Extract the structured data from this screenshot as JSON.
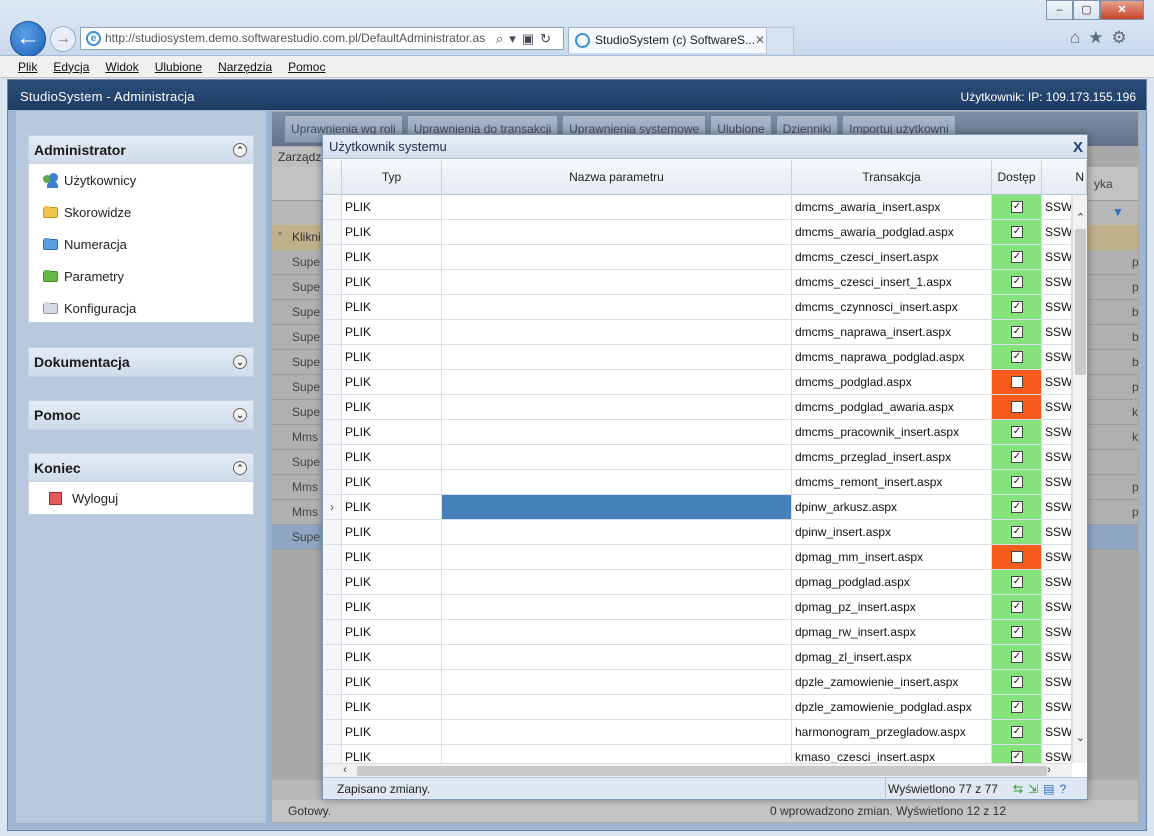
{
  "browser": {
    "url": "http://studiosystem.demo.softwarestudio.com.pl/DefaultAdministrator.as",
    "tab_title": "StudioSystem (c) SoftwareS...",
    "tab_close": "✕"
  },
  "menu": [
    "Plik",
    "Edycja",
    "Widok",
    "Ulubione",
    "Narzędzia",
    "Pomoc"
  ],
  "app": {
    "title": "StudioSystem - Administracja",
    "user": "Użytkownik: IP: 109.173.155.196"
  },
  "nav": {
    "administrator": {
      "title": "Administrator",
      "items": [
        "Użytkownicy",
        "Skorowidze",
        "Numeracja",
        "Parametry",
        "Konfiguracja"
      ]
    },
    "dokumentacja": {
      "title": "Dokumentacja"
    },
    "pomoc": {
      "title": "Pomoc"
    },
    "koniec": {
      "title": "Koniec",
      "items": [
        "Wyloguj"
      ]
    }
  },
  "background": {
    "toolbar": [
      "Uprawnienia wg roli",
      "Uprawnienia do transakcji",
      "Uprawnienia systemowe",
      "Ulubione",
      "Dzienniki",
      "Importuj użytkowni"
    ],
    "section_label": "Zarządz",
    "header_fragment": "yka",
    "new_row": "Klikni",
    "rows": [
      {
        "c1": "Supe",
        "c2": "p"
      },
      {
        "c1": "Supe",
        "c2": "p"
      },
      {
        "c1": "Supe",
        "c2": "b"
      },
      {
        "c1": "Supe",
        "c2": "b"
      },
      {
        "c1": "Supe",
        "c2": "b"
      },
      {
        "c1": "Supe",
        "c2": "p"
      },
      {
        "c1": "Supe",
        "c2": "k"
      },
      {
        "c1": "Mms",
        "c2": "k"
      },
      {
        "c1": "Supe",
        "c2": ""
      },
      {
        "c1": "Mms",
        "c2": "p"
      },
      {
        "c1": "Mms",
        "c2": "p"
      },
      {
        "c1": "Supe",
        "c2": ""
      }
    ],
    "status_left": "Gotowy.",
    "status_right": "0 wprowadzono zmian.  Wyświetlono 12 z 12"
  },
  "modal": {
    "title": "Użytkownik systemu",
    "close": "X",
    "columns": {
      "typ": "Typ",
      "nazwa": "Nazwa parametru",
      "transakcja": "Transakcja",
      "dostep": "Dostęp",
      "more": "N"
    },
    "rows": [
      {
        "typ": "PLIK",
        "param": "",
        "trans": "dmcms_awaria_insert.aspx",
        "dostep": true,
        "more": "SSW"
      },
      {
        "typ": "PLIK",
        "param": "",
        "trans": "dmcms_awaria_podglad.aspx",
        "dostep": true,
        "more": "SSW"
      },
      {
        "typ": "PLIK",
        "param": "",
        "trans": "dmcms_czesci_insert.aspx",
        "dostep": true,
        "more": "SSW"
      },
      {
        "typ": "PLIK",
        "param": "",
        "trans": "dmcms_czesci_insert_1.aspx",
        "dostep": true,
        "more": "SSW"
      },
      {
        "typ": "PLIK",
        "param": "",
        "trans": "dmcms_czynnosci_insert.aspx",
        "dostep": true,
        "more": "SSW"
      },
      {
        "typ": "PLIK",
        "param": "",
        "trans": "dmcms_naprawa_insert.aspx",
        "dostep": true,
        "more": "SSW"
      },
      {
        "typ": "PLIK",
        "param": "",
        "trans": "dmcms_naprawa_podglad.aspx",
        "dostep": true,
        "more": "SSW"
      },
      {
        "typ": "PLIK",
        "param": "",
        "trans": "dmcms_podglad.aspx",
        "dostep": false,
        "more": "SSW"
      },
      {
        "typ": "PLIK",
        "param": "",
        "trans": "dmcms_podglad_awaria.aspx",
        "dostep": false,
        "more": "SSW"
      },
      {
        "typ": "PLIK",
        "param": "",
        "trans": "dmcms_pracownik_insert.aspx",
        "dostep": true,
        "more": "SSW"
      },
      {
        "typ": "PLIK",
        "param": "",
        "trans": "dmcms_przeglad_insert.aspx",
        "dostep": true,
        "more": "SSW"
      },
      {
        "typ": "PLIK",
        "param": "",
        "trans": "dmcms_remont_insert.aspx",
        "dostep": true,
        "more": "SSW"
      },
      {
        "typ": "PLIK",
        "param": "",
        "trans": "dpinw_arkusz.aspx",
        "dostep": true,
        "more": "SSW",
        "selected": true
      },
      {
        "typ": "PLIK",
        "param": "",
        "trans": "dpinw_insert.aspx",
        "dostep": true,
        "more": "SSW"
      },
      {
        "typ": "PLIK",
        "param": "",
        "trans": "dpmag_mm_insert.aspx",
        "dostep": false,
        "more": "SSW"
      },
      {
        "typ": "PLIK",
        "param": "",
        "trans": "dpmag_podglad.aspx",
        "dostep": true,
        "more": "SSW"
      },
      {
        "typ": "PLIK",
        "param": "",
        "trans": "dpmag_pz_insert.aspx",
        "dostep": true,
        "more": "SSW"
      },
      {
        "typ": "PLIK",
        "param": "",
        "trans": "dpmag_rw_insert.aspx",
        "dostep": true,
        "more": "SSW"
      },
      {
        "typ": "PLIK",
        "param": "",
        "trans": "dpmag_zl_insert.aspx",
        "dostep": true,
        "more": "SSW"
      },
      {
        "typ": "PLIK",
        "param": "",
        "trans": "dpzle_zamowienie_insert.aspx",
        "dostep": true,
        "more": "SSW"
      },
      {
        "typ": "PLIK",
        "param": "",
        "trans": "dpzle_zamowienie_podglad.aspx",
        "dostep": true,
        "more": "SSW"
      },
      {
        "typ": "PLIK",
        "param": "",
        "trans": "harmonogram_przegladow.aspx",
        "dostep": true,
        "more": "SSW"
      },
      {
        "typ": "PLIK",
        "param": "",
        "trans": "kmaso_czesci_insert.aspx",
        "dostep": true,
        "more": "SSW"
      }
    ],
    "status_message": "Zapisano zmiany.",
    "status_count": "Wyświetlono 77 z 77"
  },
  "colors": {
    "access_yes": "#86e27c",
    "access_no": "#f45b1c",
    "selected": "#4581b8",
    "header": "#1e3d66"
  }
}
